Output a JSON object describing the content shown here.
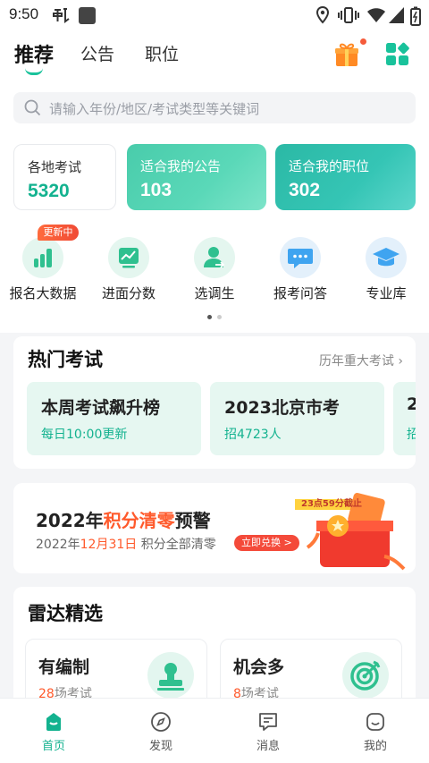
{
  "status_bar": {
    "time": "9:50"
  },
  "header": {
    "tabs": [
      {
        "label": "推荐",
        "active": true
      },
      {
        "label": "公告",
        "active": false
      },
      {
        "label": "职位",
        "active": false
      }
    ],
    "gift_icon": "gift-icon",
    "apps_icon": "grid-apps-icon"
  },
  "search": {
    "placeholder": "请输入年份/地区/考试类型等关键词"
  },
  "stats": [
    {
      "label": "各地考试",
      "value": "5320"
    },
    {
      "label": "适合我的公告",
      "value": "103"
    },
    {
      "label": "适合我的职位",
      "value": "302"
    }
  ],
  "quick": {
    "badge": "更新中",
    "items": [
      {
        "label": "报名大数据",
        "icon": "bar-chart-icon"
      },
      {
        "label": "进面分数",
        "icon": "trend-chart-icon"
      },
      {
        "label": "选调生",
        "icon": "user-transfer-icon"
      },
      {
        "label": "报考问答",
        "icon": "chat-bubble-icon"
      },
      {
        "label": "专业库",
        "icon": "graduation-cap-icon"
      }
    ]
  },
  "hot": {
    "title": "热门考试",
    "link": "历年重大考试",
    "cards": [
      {
        "title": "本周考试飙升榜",
        "sub": "每日10:00更新"
      },
      {
        "title": "2023北京市考",
        "sub": "招4723人"
      },
      {
        "title": "2",
        "sub": "招"
      }
    ]
  },
  "promo": {
    "title_a": "2022年",
    "title_b": "积分清零",
    "title_c": "预警",
    "sub_a": "2022年",
    "sub_b": "12月31日",
    "sub_c": " 积分全部清零",
    "button": "立即兑换 >",
    "countdown": "23点59分截止"
  },
  "radar": {
    "title": "雷达精选",
    "cards": [
      {
        "title": "有编制",
        "count": "28",
        "unit": "场考试",
        "icon": "stamp-icon"
      },
      {
        "title": "机会多",
        "count": "8",
        "unit": "场考试",
        "icon": "target-icon"
      }
    ]
  },
  "bottom_nav": [
    {
      "label": "首页",
      "icon": "home-icon",
      "active": true
    },
    {
      "label": "发现",
      "icon": "compass-icon",
      "active": false
    },
    {
      "label": "消息",
      "icon": "message-icon",
      "active": false
    },
    {
      "label": "我的",
      "icon": "profile-icon",
      "active": false
    }
  ],
  "colors": {
    "accent": "#13b28f",
    "warning": "#ff5a2c"
  }
}
